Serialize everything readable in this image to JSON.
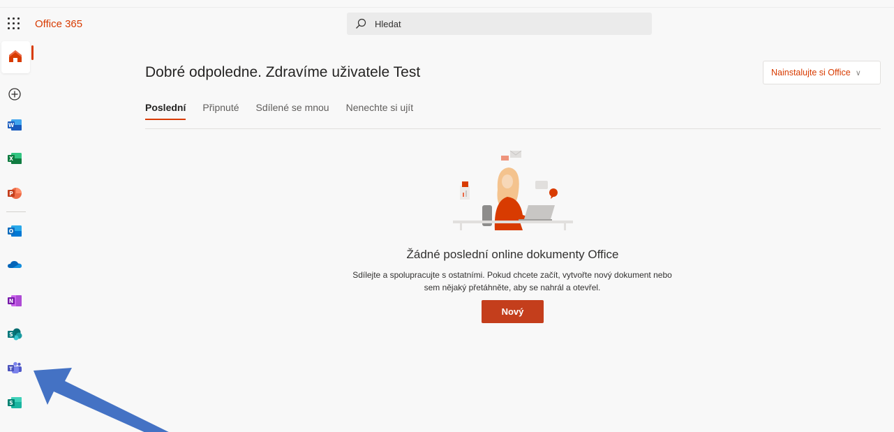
{
  "header": {
    "brand": "Office 365",
    "search_placeholder": "Hledat"
  },
  "rail": {
    "items": [
      {
        "name": "home",
        "color": "#d83b01"
      },
      {
        "name": "create"
      },
      {
        "name": "word",
        "letter": "W",
        "color": "#185abd"
      },
      {
        "name": "excel",
        "letter": "X",
        "color": "#107c41"
      },
      {
        "name": "powerpoint",
        "letter": "P",
        "color": "#c43e1c"
      },
      {
        "name": "outlook",
        "letter": "O",
        "color": "#0f6cbd"
      },
      {
        "name": "onedrive",
        "color": "#0364b8"
      },
      {
        "name": "onenote",
        "letter": "N",
        "color": "#7719aa"
      },
      {
        "name": "sharepoint",
        "letter": "S",
        "color": "#036c70"
      },
      {
        "name": "teams",
        "color": "#5059c9"
      },
      {
        "name": "sway",
        "letter": "S",
        "color": "#008272"
      }
    ]
  },
  "main": {
    "greeting": "Dobré odpoledne. Zdravíme uživatele Test",
    "install_label": "Nainstalujte si Office",
    "tabs": [
      {
        "label": "Poslední",
        "active": true
      },
      {
        "label": "Připnuté"
      },
      {
        "label": "Sdílené se mnou"
      },
      {
        "label": "Nenechte si ujít"
      }
    ],
    "empty": {
      "title": "Žádné poslední online dokumenty Office",
      "line1": "Sdílejte a spolupracujte s ostatními. Pokud chcete začít, vytvořte nový dokument nebo",
      "line2": "sem nějaký přetáhněte, aby se nahrál a otevřel.",
      "button": "Nový"
    }
  },
  "colors": {
    "accent": "#d83b01",
    "annotation_arrow": "#4472c4"
  }
}
